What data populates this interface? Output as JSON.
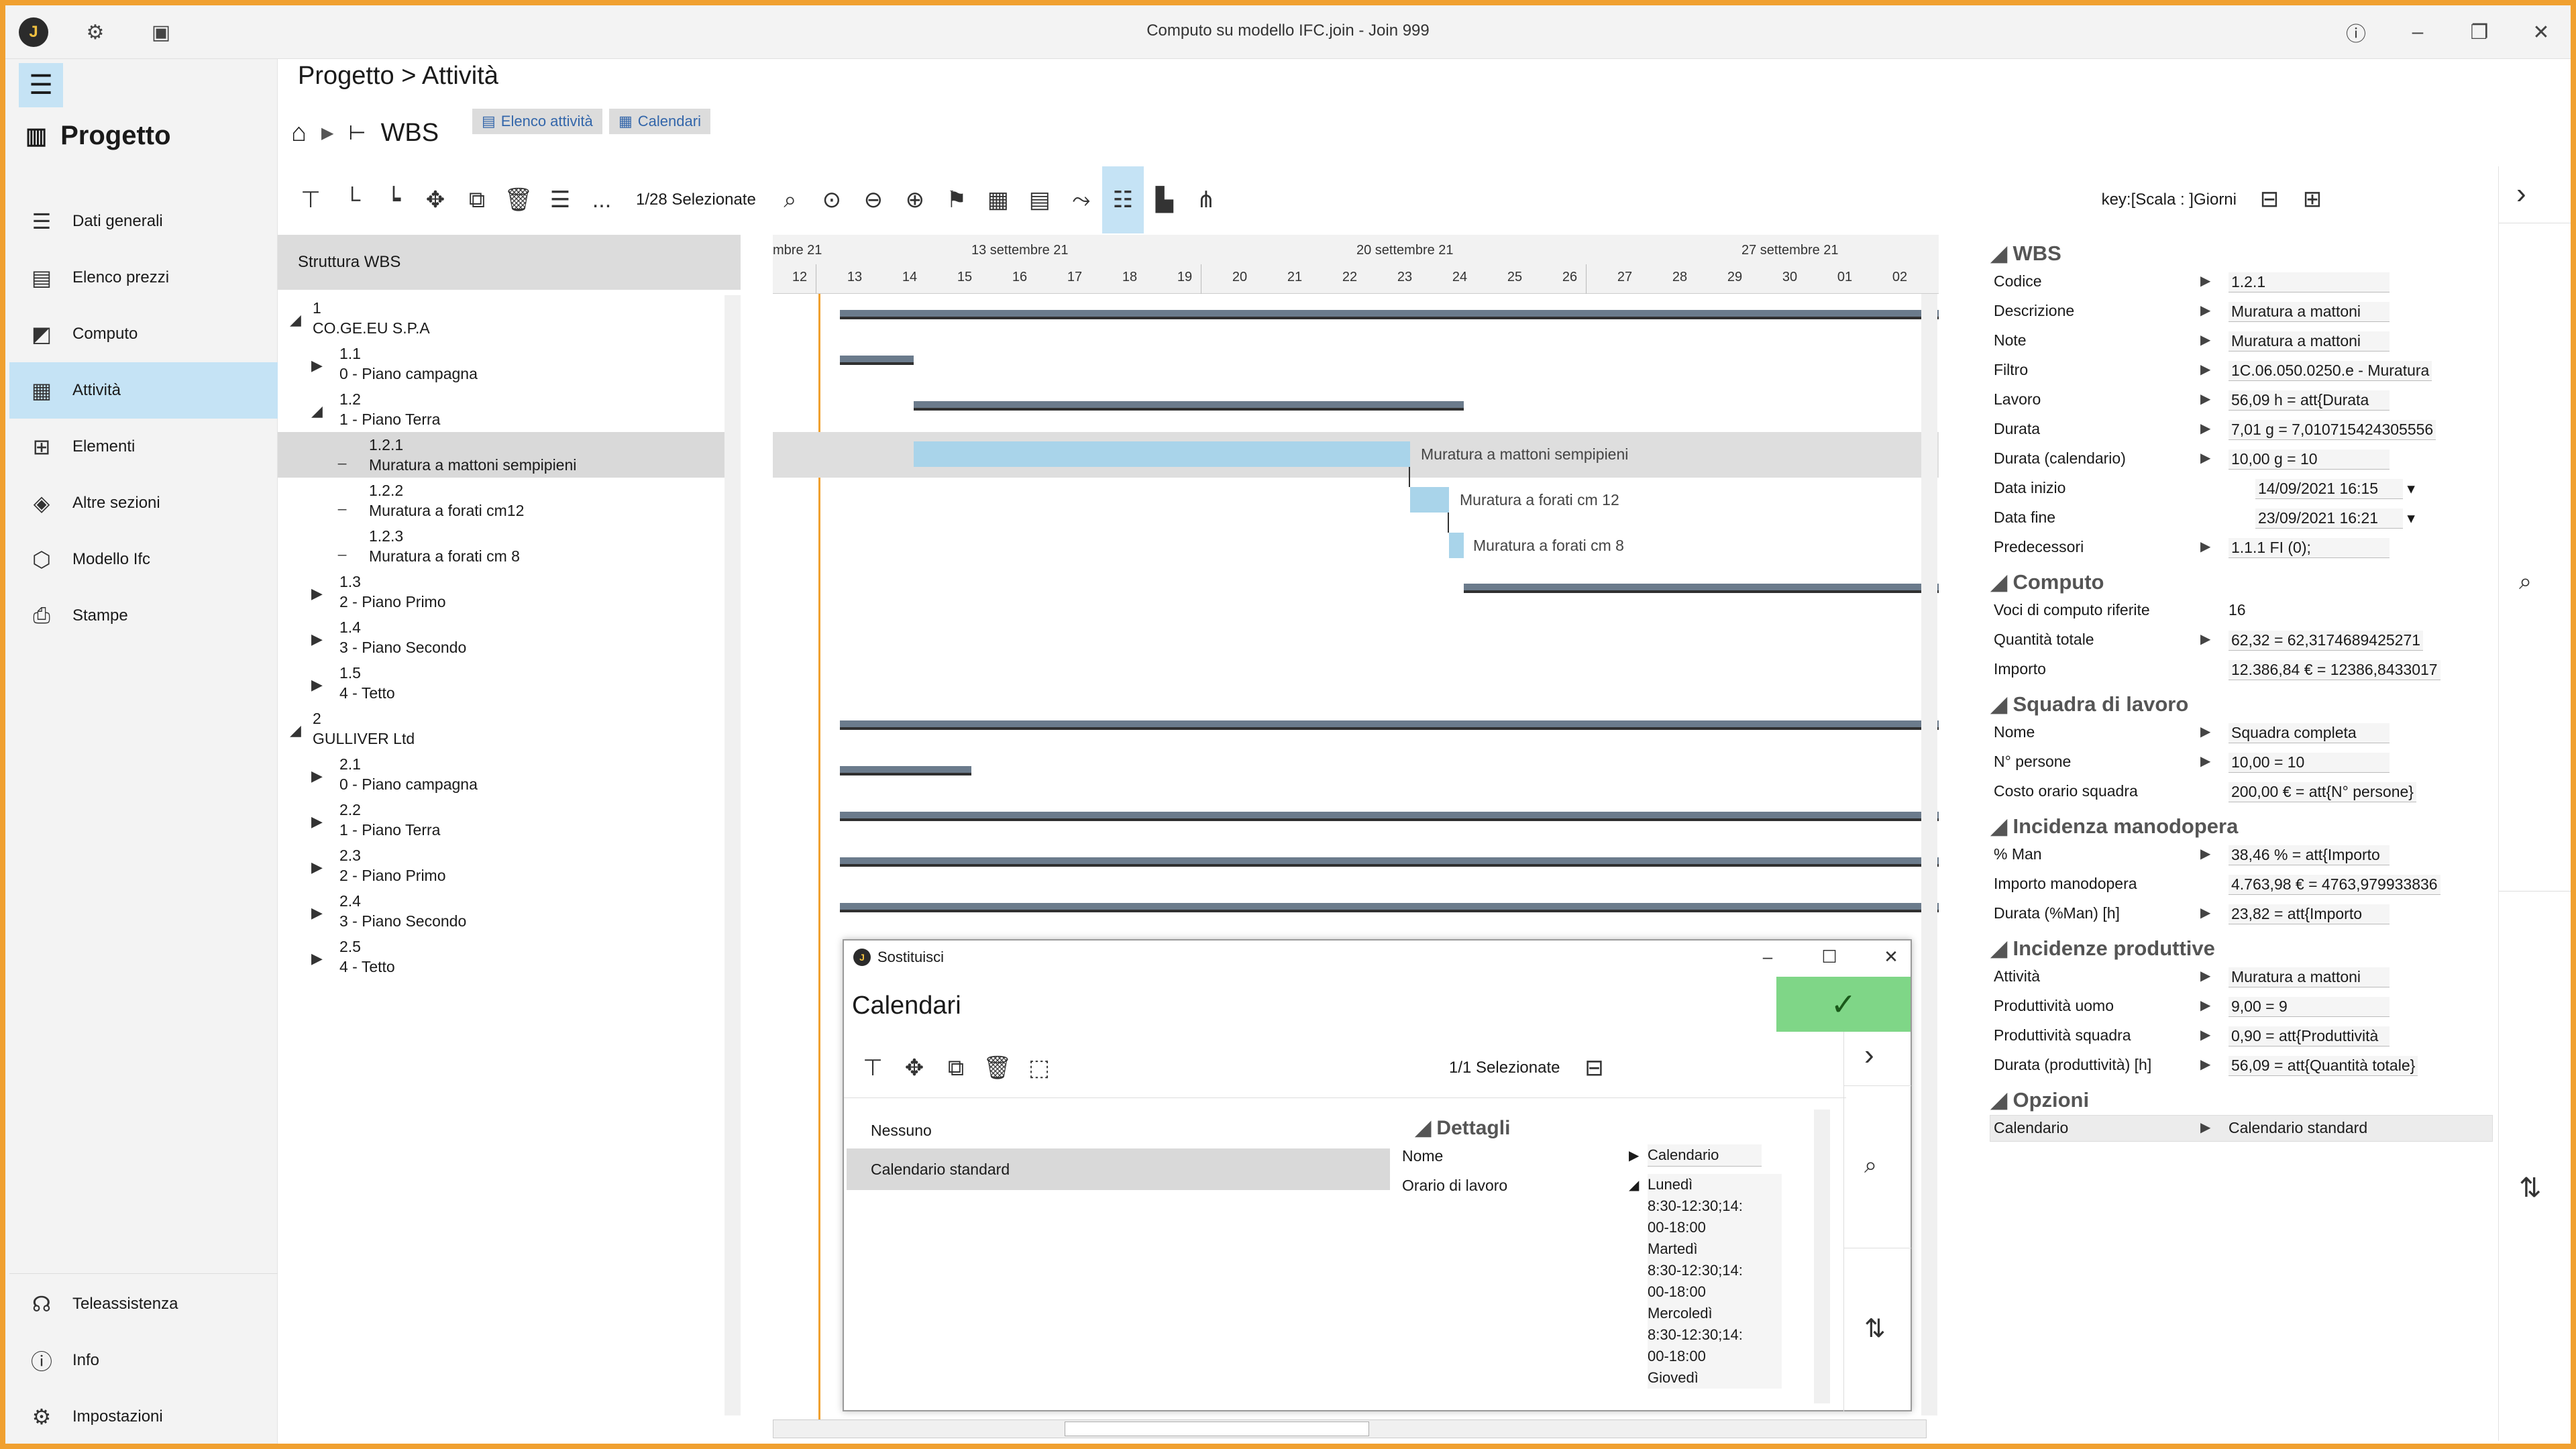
{
  "window": {
    "title": "Computo su modello IFC.join - Join 999",
    "logo_letter": "J"
  },
  "sidebar": {
    "project_title": "Progetto",
    "items": [
      {
        "label": "Dati generali",
        "icon": "document-list-icon"
      },
      {
        "label": "Elenco prezzi",
        "icon": "price-list-icon"
      },
      {
        "label": "Computo",
        "icon": "chart-icon"
      },
      {
        "label": "Attività",
        "icon": "clipboard-icon"
      },
      {
        "label": "Elementi",
        "icon": "grid-icon"
      },
      {
        "label": "Altre sezioni",
        "icon": "layers-icon"
      },
      {
        "label": "Modello Ifc",
        "icon": "cube-icon"
      },
      {
        "label": "Stampe",
        "icon": "printer-icon"
      }
    ],
    "bottom": [
      {
        "label": "Teleassistenza",
        "icon": "headset-icon"
      },
      {
        "label": "Info",
        "icon": "info-icon"
      },
      {
        "label": "Impostazioni",
        "icon": "gear-icon"
      }
    ]
  },
  "header": {
    "breadcrumb": "Progetto > Attività",
    "wbs_label": "WBS",
    "pill1": "Elenco attività",
    "pill2": "Calendari"
  },
  "toolbar": {
    "selection": "1/28 Selezionate",
    "key": "key:[Scala : ]Giorni",
    "ellipsis": "..."
  },
  "wbs": {
    "header": "Struttura WBS",
    "rows": [
      {
        "code": "1",
        "label": "CO.GE.EU S.P.A",
        "expander": "◢"
      },
      {
        "code": "1.1",
        "label": "0 - Piano campagna",
        "expander": "▶"
      },
      {
        "code": "1.2",
        "label": "1 - Piano Terra",
        "expander": "◢"
      },
      {
        "code": "1.2.1",
        "label": "Muratura a mattoni sempipieni",
        "expander": "_"
      },
      {
        "code": "1.2.2",
        "label": "Muratura a forati cm12",
        "expander": "_"
      },
      {
        "code": "1.2.3",
        "label": "Muratura a forati cm 8",
        "expander": "_"
      },
      {
        "code": "1.3",
        "label": "2 - Piano Primo",
        "expander": "▶"
      },
      {
        "code": "1.4",
        "label": "3 - Piano Secondo",
        "expander": "▶"
      },
      {
        "code": "1.5",
        "label": "4 - Tetto",
        "expander": "▶"
      },
      {
        "code": "2",
        "label": "GULLIVER Ltd",
        "expander": "◢"
      },
      {
        "code": "2.1",
        "label": "0 - Piano campagna",
        "expander": "▶"
      },
      {
        "code": "2.2",
        "label": "1 - Piano Terra",
        "expander": "▶"
      },
      {
        "code": "2.3",
        "label": "2 - Piano Primo",
        "expander": "▶"
      },
      {
        "code": "2.4",
        "label": "3 - Piano Secondo",
        "expander": "▶"
      },
      {
        "code": "2.5",
        "label": "4 - Tetto",
        "expander": "▶"
      }
    ]
  },
  "gantt": {
    "months": [
      "mbre 21",
      "13 settembre 21",
      "20 settembre 21",
      "27 settembre 21"
    ],
    "days": [
      "12",
      "13",
      "14",
      "15",
      "16",
      "17",
      "18",
      "19",
      "20",
      "21",
      "22",
      "23",
      "24",
      "25",
      "26",
      "27",
      "28",
      "29",
      "30",
      "01",
      "02"
    ],
    "task_labels": [
      "Muratura a mattoni sempipieni",
      "Muratura a forati cm 12",
      "Muratura a forati cm 8"
    ]
  },
  "dialog": {
    "title": "Sostituisci",
    "heading": "Calendari",
    "selection": "1/1 Selezionate",
    "items": [
      "Nessuno",
      "Calendario standard"
    ],
    "details_section": "Dettagli",
    "nome_label": "Nome",
    "nome_value": "Calendario",
    "orario_label": "Orario di lavoro",
    "orario_lines": [
      "Lunedì",
      "8:30-12:30;14:",
      "00-18:00",
      "Martedì",
      "8:30-12:30;14:",
      "00-18:00",
      "Mercoledì",
      "8:30-12:30;14:",
      "00-18:00",
      "Giovedì"
    ]
  },
  "props": {
    "wbs": {
      "title": "WBS",
      "rows": [
        {
          "label": "Codice",
          "value": "1.2.1"
        },
        {
          "label": "Descrizione",
          "value": "Muratura a mattoni"
        },
        {
          "label": "Note",
          "value": "Muratura a mattoni"
        },
        {
          "label": "Filtro",
          "value": "1C.06.050.0250.e - Muratura"
        },
        {
          "label": "Lavoro",
          "value": "56,09 h =  att{Durata"
        },
        {
          "label": "Durata",
          "value": "7,01 g =  7,010715424305556"
        },
        {
          "label": "Durata (calendario)",
          "value": "10,00 g =  10"
        },
        {
          "label": "Data inizio",
          "value": "14/09/2021 16:15"
        },
        {
          "label": "Data fine",
          "value": "23/09/2021 16:21"
        },
        {
          "label": "Predecessori",
          "value": "1.1.1 FI (0);"
        }
      ]
    },
    "computo": {
      "title": "Computo",
      "rows": [
        {
          "label": "Voci di computo riferite",
          "value": "16"
        },
        {
          "label": "Quantità totale",
          "value": "62,32 =  62,3174689425271"
        },
        {
          "label": "Importo",
          "value": "12.386,84 € =  12386,8433017"
        }
      ]
    },
    "squadra": {
      "title": "Squadra di lavoro",
      "rows": [
        {
          "label": "Nome",
          "value": "Squadra completa"
        },
        {
          "label": "N° persone",
          "value": "10,00 =  10"
        },
        {
          "label": "Costo orario squadra",
          "value": "200,00 € =  att{N° persone}"
        }
      ]
    },
    "manodopera": {
      "title": "Incidenza manodopera",
      "rows": [
        {
          "label": "% Man",
          "value": "38,46 % =  att{Importo"
        },
        {
          "label": "Importo manodopera",
          "value": "4.763,98 € =  4763,979933836"
        },
        {
          "label": "Durata (%Man) [h]",
          "value": "23,82 =  att{Importo"
        }
      ]
    },
    "produttive": {
      "title": "Incidenze produttive",
      "rows": [
        {
          "label": "Attività",
          "value": "Muratura a mattoni"
        },
        {
          "label": "Produttività uomo",
          "value": "9,00 =  9"
        },
        {
          "label": "Produttività squadra",
          "value": "0,90 =  att{Produttività"
        },
        {
          "label": "Durata (produttività) [h]",
          "value": "56,09 =  att{Quantità totale}"
        }
      ]
    },
    "opzioni": {
      "title": "Opzioni",
      "rows": [
        {
          "label": "Calendario",
          "value": "Calendario standard"
        }
      ]
    }
  }
}
